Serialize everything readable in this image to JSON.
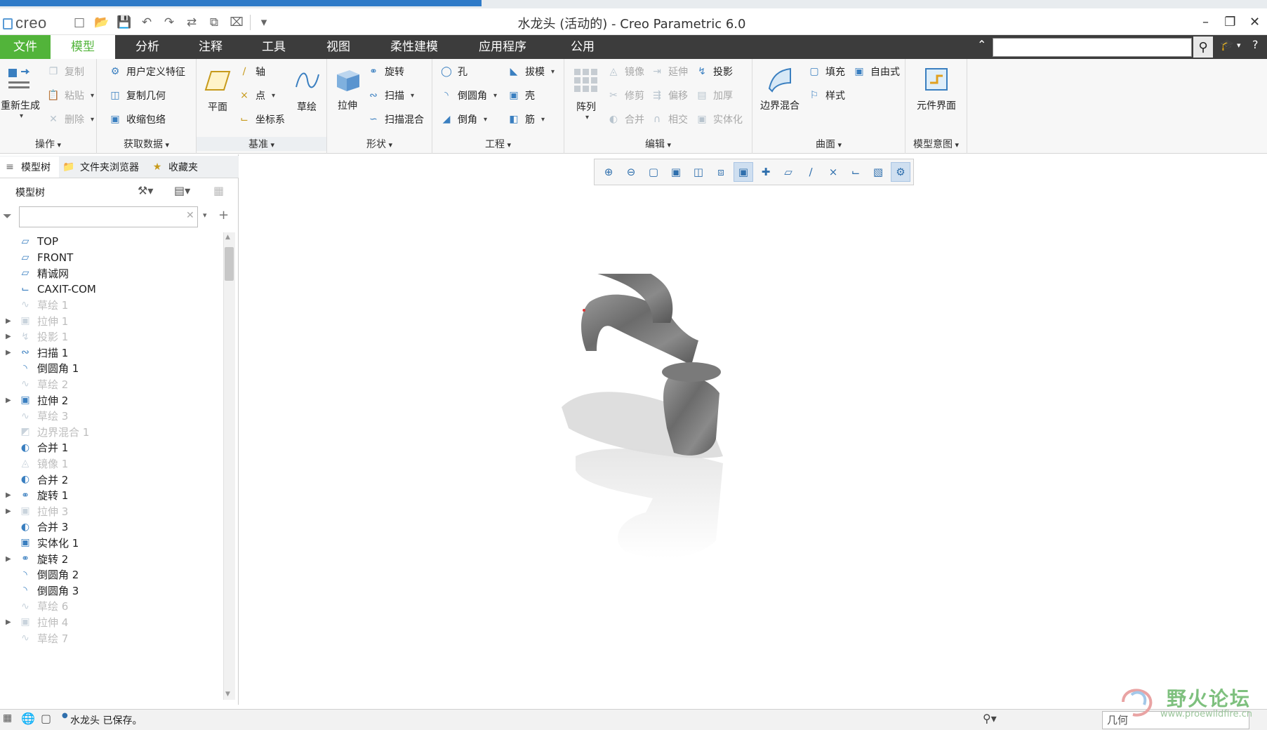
{
  "app": {
    "logo": "creo",
    "window_title": "水龙头 (活动的) - Creo Parametric 6.0"
  },
  "menu": {
    "tabs": [
      "文件",
      "模型",
      "分析",
      "注释",
      "工具",
      "视图",
      "柔性建模",
      "应用程序",
      "公用"
    ],
    "active_tab": "模型",
    "search_placeholder": ""
  },
  "ribbon": {
    "groups": {
      "operations": {
        "label": "操作",
        "regenerate": "重新生成",
        "copy": "复制",
        "paste": "粘贴",
        "delete": "删除"
      },
      "get_data": {
        "label": "获取数据",
        "udf": "用户定义特征",
        "copy_geom": "复制几何",
        "shrinkwrap": "收缩包络"
      },
      "datum": {
        "label": "基准",
        "plane": "平面",
        "axis": "轴",
        "point": "点",
        "csys": "坐标系",
        "sketch": "草绘"
      },
      "shapes": {
        "label": "形状",
        "extrude": "拉伸",
        "revolve": "旋转",
        "sweep": "扫描",
        "swept_blend": "扫描混合"
      },
      "engineering": {
        "label": "工程",
        "hole": "孔",
        "round": "倒圆角",
        "chamfer": "倒角",
        "draft": "拔模",
        "shell": "壳",
        "rib": "筋"
      },
      "editing": {
        "label": "编辑",
        "pattern": "阵列",
        "mirror": "镜像",
        "trim": "修剪",
        "merge": "合并",
        "extend": "延伸",
        "offset": "偏移",
        "intersect": "相交",
        "project": "投影",
        "thicken": "加厚",
        "solidify": "实体化"
      },
      "surfaces": {
        "label": "曲面",
        "boundary_blend": "边界混合",
        "fill": "填充",
        "freestyle": "自由式",
        "style": "样式"
      },
      "model_intent": {
        "label": "模型意图",
        "component_interface": "元件界面"
      }
    }
  },
  "navigator": {
    "tabs": [
      "模型树",
      "文件夹浏览器",
      "收藏夹"
    ],
    "header": "模型树",
    "filter_value": "",
    "items": [
      {
        "label": "TOP",
        "icon": "datum-plane-icon",
        "expandable": false,
        "suppressed": false
      },
      {
        "label": "FRONT",
        "icon": "datum-plane-icon",
        "expandable": false,
        "suppressed": false
      },
      {
        "label": "精诚网",
        "icon": "datum-plane-icon",
        "expandable": false,
        "suppressed": false
      },
      {
        "label": "CAXIT-COM",
        "icon": "csys-icon",
        "expandable": false,
        "suppressed": false
      },
      {
        "label": "草绘 1",
        "icon": "sketch-icon",
        "expandable": false,
        "suppressed": true
      },
      {
        "label": "拉伸 1",
        "icon": "extrude-icon",
        "expandable": true,
        "suppressed": true
      },
      {
        "label": "投影 1",
        "icon": "project-icon",
        "expandable": true,
        "suppressed": true
      },
      {
        "label": "扫描 1",
        "icon": "sweep-icon",
        "expandable": true,
        "suppressed": false
      },
      {
        "label": "倒圆角 1",
        "icon": "round-icon",
        "expandable": false,
        "suppressed": false
      },
      {
        "label": "草绘 2",
        "icon": "sketch-icon",
        "expandable": false,
        "suppressed": true
      },
      {
        "label": "拉伸 2",
        "icon": "extrude-icon",
        "expandable": true,
        "suppressed": false
      },
      {
        "label": "草绘 3",
        "icon": "sketch-icon",
        "expandable": false,
        "suppressed": true
      },
      {
        "label": "边界混合 1",
        "icon": "boundary-blend-icon",
        "expandable": false,
        "suppressed": true
      },
      {
        "label": "合并 1",
        "icon": "merge-icon",
        "expandable": false,
        "suppressed": false
      },
      {
        "label": "镜像 1",
        "icon": "mirror-icon",
        "expandable": false,
        "suppressed": true
      },
      {
        "label": "合并 2",
        "icon": "merge-icon",
        "expandable": false,
        "suppressed": false
      },
      {
        "label": "旋转 1",
        "icon": "revolve-icon",
        "expandable": true,
        "suppressed": false
      },
      {
        "label": "拉伸 3",
        "icon": "extrude-icon",
        "expandable": true,
        "suppressed": true
      },
      {
        "label": "合并 3",
        "icon": "merge-icon",
        "expandable": false,
        "suppressed": false
      },
      {
        "label": "实体化 1",
        "icon": "solidify-icon",
        "expandable": false,
        "suppressed": false
      },
      {
        "label": "旋转 2",
        "icon": "revolve-icon",
        "expandable": true,
        "suppressed": false
      },
      {
        "label": "倒圆角 2",
        "icon": "round-icon",
        "expandable": false,
        "suppressed": false
      },
      {
        "label": "倒圆角 3",
        "icon": "round-icon",
        "expandable": false,
        "suppressed": false
      },
      {
        "label": "草绘 6",
        "icon": "sketch-icon",
        "expandable": false,
        "suppressed": true
      },
      {
        "label": "拉伸 4",
        "icon": "extrude-icon",
        "expandable": true,
        "suppressed": true
      },
      {
        "label": "草绘 7",
        "icon": "sketch-icon",
        "expandable": false,
        "suppressed": true
      }
    ]
  },
  "status": {
    "message": "水龙头 已保存。",
    "selection_filter": "几何"
  },
  "watermark": {
    "text": "野火论坛",
    "url": "www.proewildfire.cn"
  },
  "colors": {
    "file_tab": "#52b43a",
    "menubar": "#3c3c3c",
    "accent_icon": "#3a7fc0"
  }
}
